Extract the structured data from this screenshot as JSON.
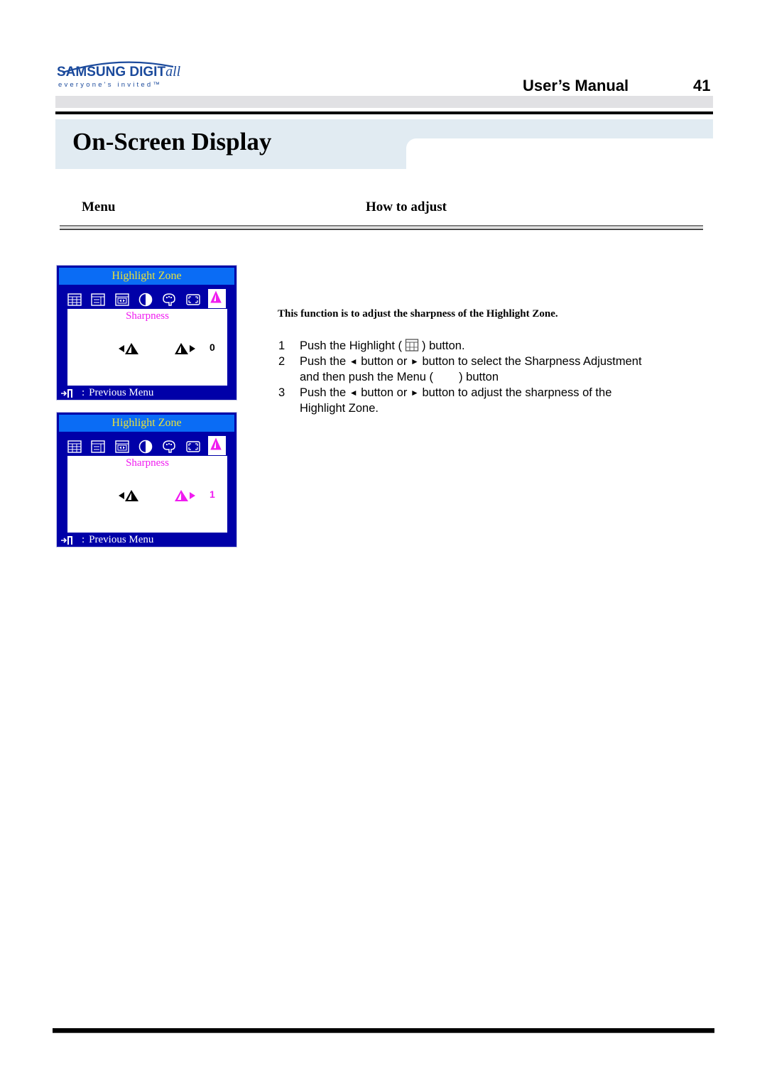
{
  "header": {
    "logo_brand": "SAMSUNG DIGIT",
    "logo_brand_suffix": "all",
    "logo_tagline": "everyone's invited™",
    "manual_title": "User’s Manual",
    "page_number": "41"
  },
  "page_title": "On-Screen Display",
  "columns": {
    "menu": "Menu",
    "how_to_adjust": "How to adjust"
  },
  "osd_panels": [
    {
      "title": "Highlight Zone",
      "icons": [
        "highlight-zone-icon",
        "window-icon",
        "size-position-icon",
        "contrast-icon",
        "color-icon",
        "full-screen-icon",
        "sharpness-icon"
      ],
      "selected_icon": "sharpness-icon",
      "label": "Sharpness",
      "decrease_symbol": "◄",
      "increase_symbol": "►",
      "value": "0",
      "active_side": "none",
      "footer": "Previous Menu",
      "footer_colon": ":"
    },
    {
      "title": "Highlight Zone",
      "icons": [
        "highlight-zone-icon",
        "window-icon",
        "size-position-icon",
        "contrast-icon",
        "color-icon",
        "full-screen-icon",
        "sharpness-icon"
      ],
      "selected_icon": "sharpness-icon",
      "label": "Sharpness",
      "decrease_symbol": "◄",
      "increase_symbol": "►",
      "value": "1",
      "active_side": "increase",
      "footer": "Previous Menu",
      "footer_colon": ":"
    }
  ],
  "colors": {
    "osd_background": "#0000a8",
    "osd_titlebar": "#0a6cf5",
    "osd_title_text": "#e8e23a",
    "osd_highlight": "#f01cf0",
    "title_band": "#e1ebf2"
  },
  "instructions": {
    "intro": "This function is to adjust the sharpness of the Highlight Zone.",
    "steps": [
      {
        "num": "1",
        "parts": [
          "Push the Highlight (",
          ") button."
        ]
      },
      {
        "num": "2",
        "parts": [
          "Push the",
          "button or",
          "button to select the Sharpness Adjustment"
        ],
        "continuation": [
          "and then push the Menu (",
          ") button"
        ]
      },
      {
        "num": "3",
        "parts": [
          "Push the",
          "button or",
          "button to adjust the sharpness of the"
        ],
        "continuation": [
          "Highlight Zone."
        ]
      }
    ],
    "left_symbol": "◄",
    "right_symbol": "►"
  }
}
